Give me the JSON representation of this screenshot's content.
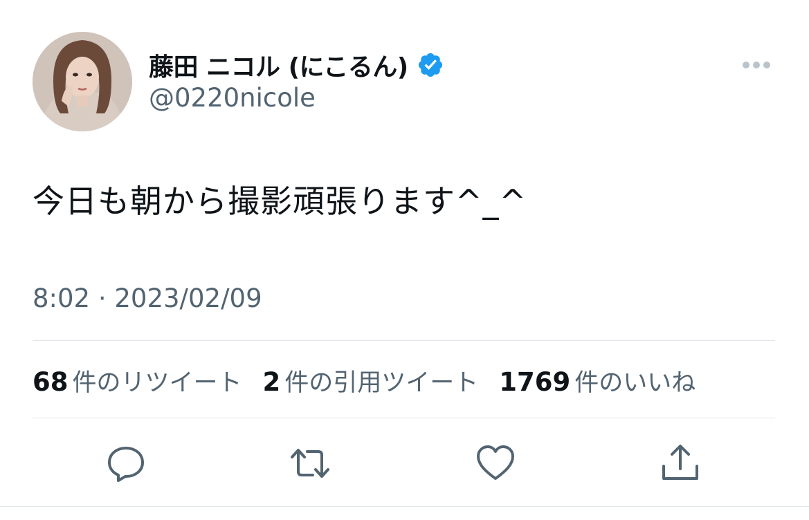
{
  "author": {
    "display_name": "藤田 ニコル (にこるん)",
    "handle": "@0220nicole",
    "verified": true,
    "verified_color": "#1d9bf0"
  },
  "tweet": {
    "text": "今日も朝から撮影頑張ります^_^",
    "timestamp": "8:02 · 2023/02/09"
  },
  "stats": [
    {
      "count": "68",
      "label": "件のリツイート"
    },
    {
      "count": "2",
      "label": "件の引用ツイート"
    },
    {
      "count": "1769",
      "label": "件のいいね"
    }
  ],
  "actions": [
    {
      "icon": "reply-icon"
    },
    {
      "icon": "retweet-icon"
    },
    {
      "icon": "like-icon"
    },
    {
      "icon": "share-icon"
    }
  ],
  "colors": {
    "text": "#0f1419",
    "secondary": "#536471",
    "divider": "#e1e6ea",
    "action_icon": "#536471"
  }
}
